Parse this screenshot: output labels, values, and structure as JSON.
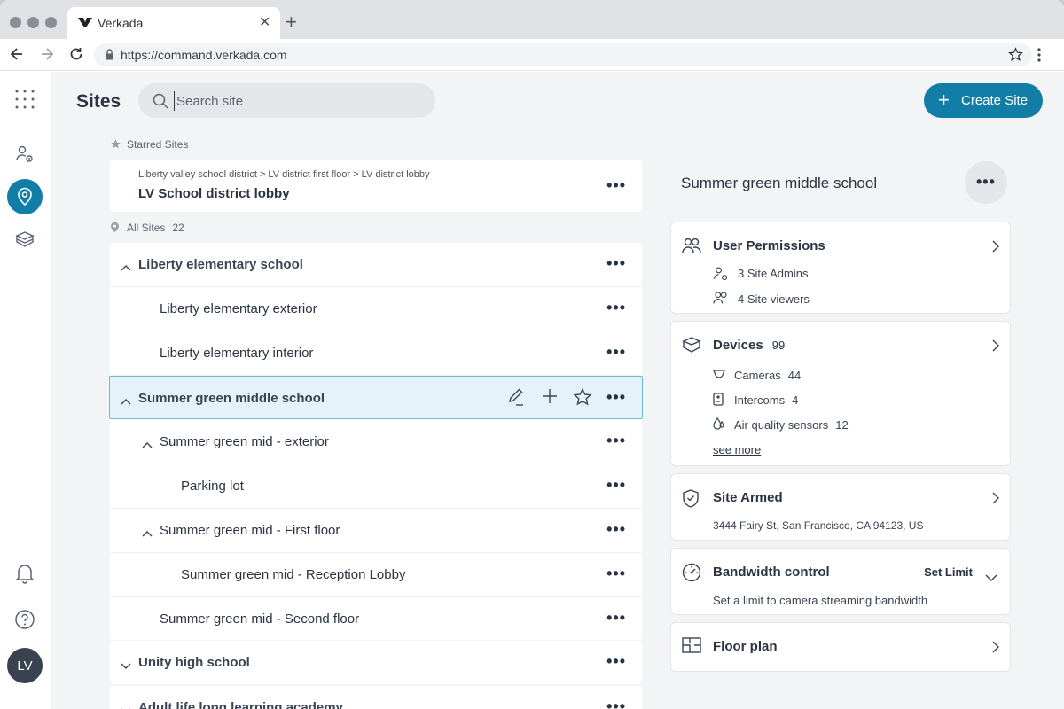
{
  "browser": {
    "tab_title": "Verkada",
    "url": "https://command.verkada.com"
  },
  "nav": {
    "avatar_initials": "LV",
    "accent": "#127ea8"
  },
  "header": {
    "title": "Sites",
    "search_placeholder": "Search site",
    "create_label": "Create Site"
  },
  "starred": {
    "label": "Starred Sites",
    "breadcrumb": "Liberty valley school district > LV district first floor > LV district lobby",
    "name": "LV School district lobby"
  },
  "all_sites": {
    "label": "All Sites",
    "count": "22",
    "rows": [
      {
        "name": "Liberty elementary school"
      },
      {
        "name": "Liberty elementary exterior"
      },
      {
        "name": "Liberty elementary interior"
      },
      {
        "name": "Summer green middle school"
      },
      {
        "name": "Summer green mid - exterior"
      },
      {
        "name": "Parking lot"
      },
      {
        "name": "Summer green mid - First floor"
      },
      {
        "name": "Summer green mid - Reception Lobby"
      },
      {
        "name": "Summer green mid - Second floor"
      },
      {
        "name": "Unity high school"
      },
      {
        "name": "Adult life long learning academy"
      }
    ]
  },
  "detail": {
    "title": "Summer green middle school",
    "permissions": {
      "title": "User Permissions",
      "admins": "3 Site Admins",
      "viewers": "4 Site viewers"
    },
    "devices": {
      "title": "Devices",
      "count": "99",
      "cameras_label": "Cameras",
      "cameras_count": "44",
      "intercoms_label": "Intercoms",
      "intercoms_count": "4",
      "air_label": "Air quality sensors",
      "air_count": "12",
      "see_more": "see more"
    },
    "armed": {
      "title": "Site Armed",
      "address": "3444 Fairy St, San Francisco, CA 94123, US"
    },
    "bandwidth": {
      "title": "Bandwidth control",
      "set_limit": "Set Limit",
      "desc": "Set a limit to camera streaming bandwidth"
    },
    "floorplan": {
      "title": "Floor plan"
    }
  },
  "ellipsis": "•••"
}
